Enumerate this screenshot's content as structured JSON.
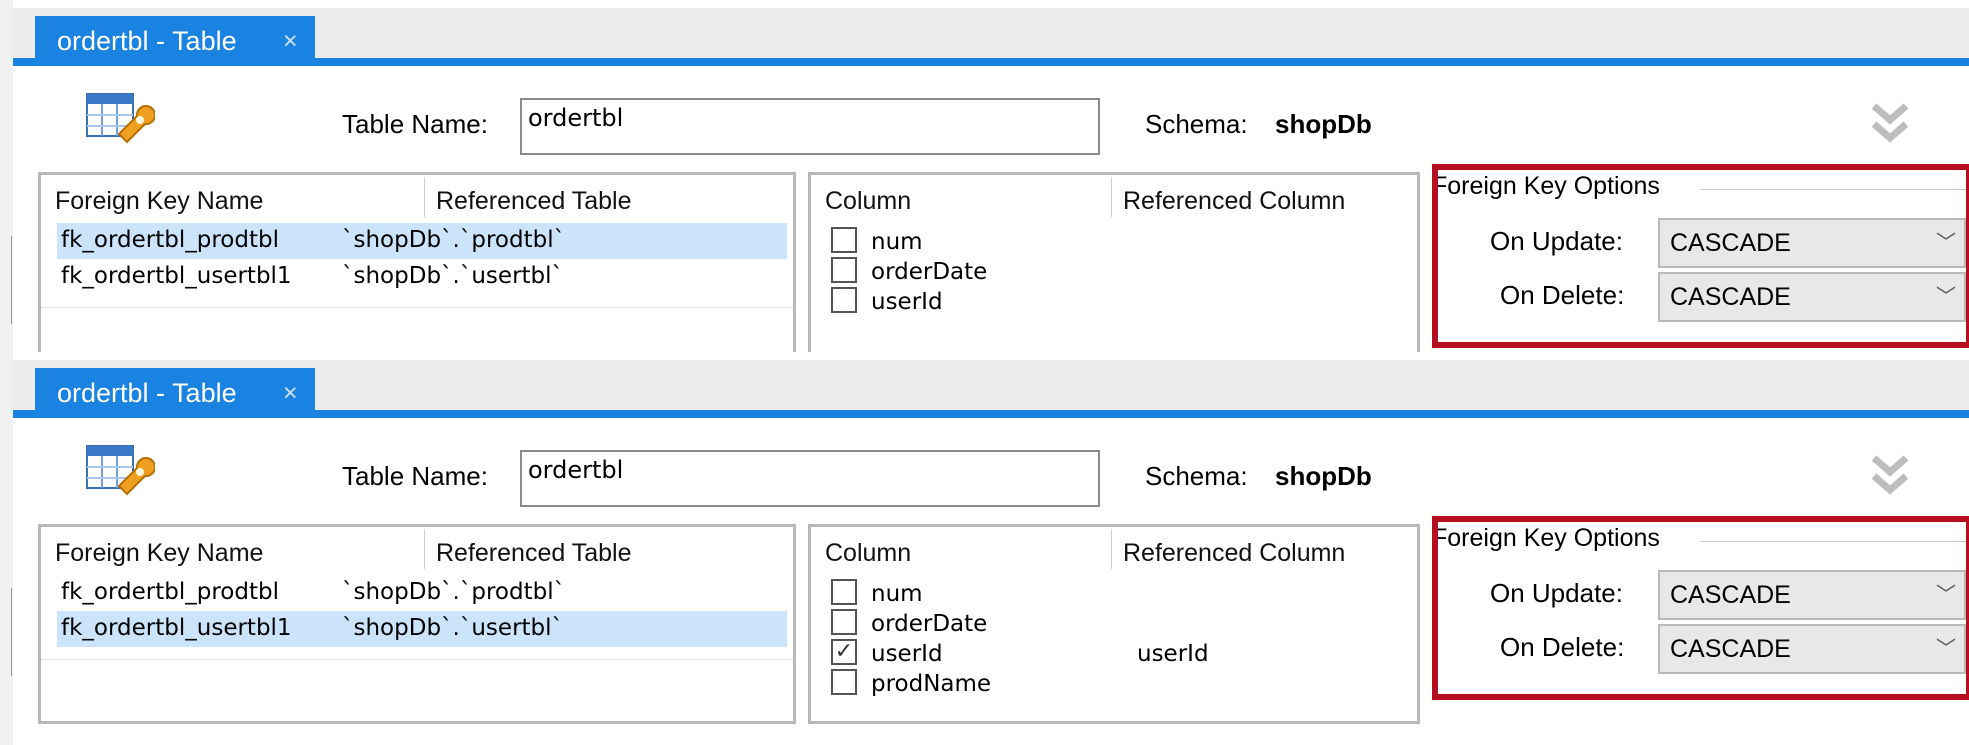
{
  "panels": [
    {
      "tab_label": "ordertbl - Table",
      "tab_close": "×",
      "table_name_label": "Table Name:",
      "table_name_value": "ordertbl",
      "schema_label": "Schema:",
      "schema_value": "shopDb",
      "fk_headers": [
        "Foreign Key Name",
        "Referenced Table"
      ],
      "fk_rows": [
        {
          "name": "fk_ordertbl_prodtbl",
          "ref": "`shopDb`.`prodtbl`",
          "selected": true
        },
        {
          "name": "fk_ordertbl_usertbl1",
          "ref": "`shopDb`.`usertbl`",
          "selected": false
        }
      ],
      "col_headers": [
        "Column",
        "Referenced Column"
      ],
      "col_rows": [
        {
          "name": "num",
          "checked": false,
          "ref": ""
        },
        {
          "name": "orderDate",
          "checked": false,
          "ref": ""
        },
        {
          "name": "userId",
          "checked": false,
          "ref": ""
        }
      ],
      "fk_options_title": "Foreign Key Options",
      "on_update_label": "On Update:",
      "on_update_value": "CASCADE",
      "on_delete_label": "On Delete:",
      "on_delete_value": "CASCADE"
    },
    {
      "tab_label": "ordertbl - Table",
      "tab_close": "×",
      "table_name_label": "Table Name:",
      "table_name_value": "ordertbl",
      "schema_label": "Schema:",
      "schema_value": "shopDb",
      "fk_headers": [
        "Foreign Key Name",
        "Referenced Table"
      ],
      "fk_rows": [
        {
          "name": "fk_ordertbl_prodtbl",
          "ref": "`shopDb`.`prodtbl`",
          "selected": false
        },
        {
          "name": "fk_ordertbl_usertbl1",
          "ref": "`shopDb`.`usertbl`",
          "selected": true
        }
      ],
      "col_headers": [
        "Column",
        "Referenced Column"
      ],
      "col_rows": [
        {
          "name": "num",
          "checked": false,
          "ref": ""
        },
        {
          "name": "orderDate",
          "checked": false,
          "ref": ""
        },
        {
          "name": "userId",
          "checked": true,
          "ref": "userId"
        },
        {
          "name": "prodName",
          "checked": false,
          "ref": ""
        }
      ],
      "fk_options_title": "Foreign Key Options",
      "on_update_label": "On Update:",
      "on_update_value": "CASCADE",
      "on_delete_label": "On Delete:",
      "on_delete_value": "CASCADE"
    }
  ],
  "colors": {
    "tab_accent": "#1a82e0",
    "selection": "#cce4fa",
    "highlight_border": "#b50f1f"
  },
  "icons": {
    "table_editor": "table-wrench-icon",
    "collapse": "double-chevron-down-icon",
    "dropdown": "chevron-down-icon",
    "checkbox_checked": "checkmark-icon"
  }
}
